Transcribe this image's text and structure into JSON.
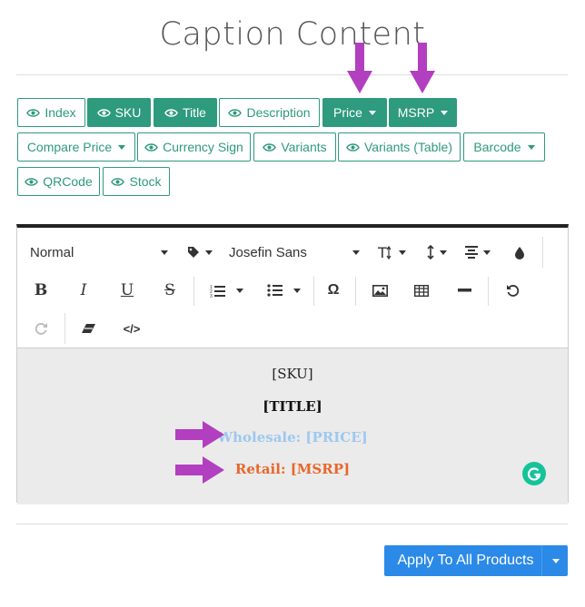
{
  "page": {
    "title": "Caption Content"
  },
  "tags": {
    "index": "Index",
    "sku": "SKU",
    "title": "Title",
    "description": "Description",
    "price": "Price",
    "msrp": "MSRP",
    "compare_price": "Compare Price",
    "currency_sign": "Currency Sign",
    "variants": "Variants",
    "variants_table": "Variants (Table)",
    "barcode": "Barcode",
    "qrcode": "QRCode",
    "stock": "Stock"
  },
  "toolbar": {
    "format": "Normal",
    "font": "Josefin Sans",
    "bold": "B",
    "italic": "I",
    "underline": "U",
    "strike": "S",
    "special_char": "Ω",
    "code": "</>"
  },
  "editor": {
    "line_sku": "[SKU]",
    "line_title": "[TITLE]",
    "line_wholesale": "Wholesale: [PRICE]",
    "line_retail": "Retail: [MSRP]"
  },
  "footer": {
    "apply_label": "Apply To All Products"
  },
  "colors": {
    "teal": "#2e9a7e",
    "wholesale": "#9ec8f0",
    "retail": "#e8672a",
    "annotation_arrow": "#b13fbf",
    "apply_button": "#2b8ae8"
  }
}
